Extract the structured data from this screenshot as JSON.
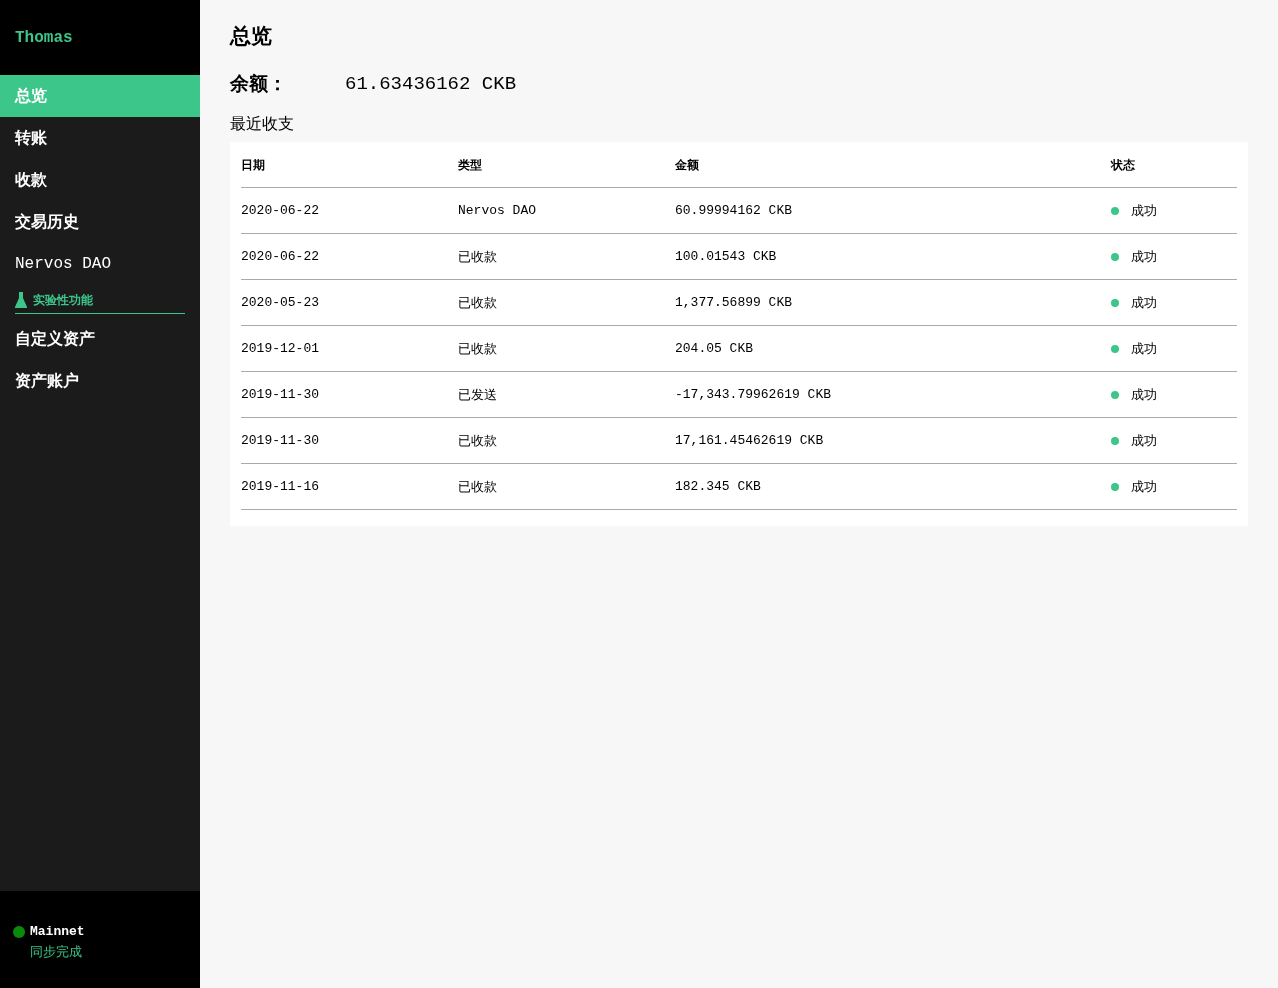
{
  "sidebar": {
    "wallet_name": "Thomas",
    "items": [
      {
        "label": "总览",
        "selected": true
      },
      {
        "label": "转账",
        "selected": false
      },
      {
        "label": "收款",
        "selected": false
      },
      {
        "label": "交易历史",
        "selected": false
      },
      {
        "label": "Nervos DAO",
        "selected": false
      }
    ],
    "experimental": {
      "label": "实验性功能",
      "items": [
        {
          "label": "自定义资产",
          "selected": false
        },
        {
          "label": "资产账户",
          "selected": false
        }
      ]
    },
    "network": {
      "name": "Mainnet",
      "color": "#0a8a0a",
      "sync": "同步完成"
    }
  },
  "title": "总览",
  "balance": {
    "label": "余额：",
    "value": "61.63436162 CKB"
  },
  "recent": {
    "title": "最近收支",
    "columns": [
      "日期",
      "类型",
      "金额",
      "状态"
    ],
    "rows": [
      {
        "date": "2020-06-22",
        "type": "Nervos DAO",
        "amount": "60.99994162 CKB",
        "status": "成功",
        "color": "#3cc68a"
      },
      {
        "date": "2020-06-22",
        "type": "已收款",
        "amount": "100.01543 CKB",
        "status": "成功",
        "color": "#3cc68a"
      },
      {
        "date": "2020-05-23",
        "type": "已收款",
        "amount": "1,377.56899 CKB",
        "status": "成功",
        "color": "#3cc68a"
      },
      {
        "date": "2019-12-01",
        "type": "已收款",
        "amount": "204.05 CKB",
        "status": "成功",
        "color": "#3cc68a"
      },
      {
        "date": "2019-11-30",
        "type": "已发送",
        "amount": "-17,343.79962619 CKB",
        "status": "成功",
        "color": "#3cc68a"
      },
      {
        "date": "2019-11-30",
        "type": "已收款",
        "amount": "17,161.45462619 CKB",
        "status": "成功",
        "color": "#3cc68a"
      },
      {
        "date": "2019-11-16",
        "type": "已收款",
        "amount": "182.345 CKB",
        "status": "成功",
        "color": "#3cc68a"
      }
    ]
  }
}
